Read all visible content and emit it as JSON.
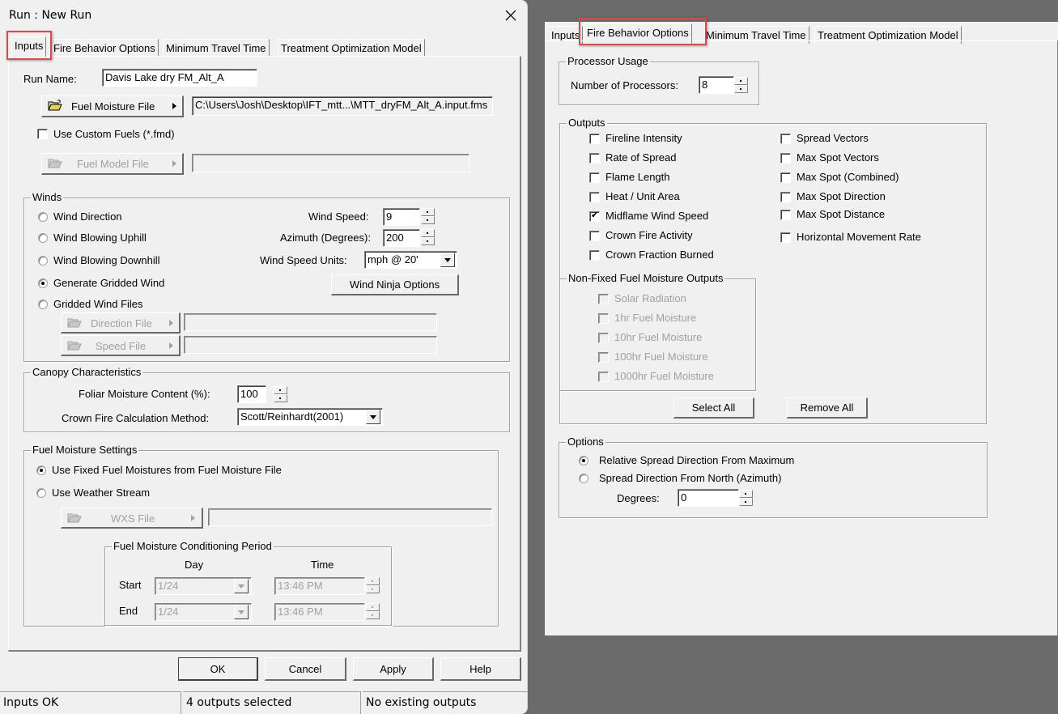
{
  "dialog": {
    "title": "Run : New Run",
    "close_icon": "close-icon",
    "tabs": [
      {
        "label": "Inputs",
        "active": true
      },
      {
        "label": "Fire Behavior Options",
        "active": false
      },
      {
        "label": "Minimum Travel Time",
        "active": false
      },
      {
        "label": "Treatment Optimization Model",
        "active": false
      }
    ],
    "inputs_tab": {
      "run_name_label": "Run Name:",
      "run_name_value": "Davis Lake dry FM_Alt_A",
      "fuel_moisture_button": "Fuel Moisture File",
      "fuel_moisture_path": "C:\\Users\\Josh\\Desktop\\IFT_mtt...\\MTT_dryFM_Alt_A.input.fms",
      "custom_fuels_label": "Use Custom Fuels (*.fmd)",
      "custom_fuels_checked": false,
      "fuel_model_button": "Fuel Model File",
      "fuel_model_path": "",
      "winds": {
        "title": "Winds",
        "options": [
          {
            "label": "Wind Direction",
            "selected": false
          },
          {
            "label": "Wind Blowing Uphill",
            "selected": false
          },
          {
            "label": "Wind Blowing Downhill",
            "selected": false
          },
          {
            "label": "Generate Gridded Wind",
            "selected": true
          },
          {
            "label": "Gridded Wind Files",
            "selected": false
          }
        ],
        "wind_speed_label": "Wind Speed:",
        "wind_speed_value": "9",
        "azimuth_label": "Azimuth (Degrees):",
        "azimuth_value": "200",
        "units_label": "Wind Speed Units:",
        "units_value": "mph @ 20'",
        "wind_ninja_button": "Wind Ninja Options",
        "direction_file_button": "Direction File",
        "direction_file_path": "",
        "speed_file_button": "Speed File",
        "speed_file_path": ""
      },
      "canopy": {
        "title": "Canopy Characteristics",
        "foliar_label": "Foliar Moisture Content (%):",
        "foliar_value": "100",
        "crown_method_label": "Crown Fire Calculation Method:",
        "crown_method_value": "Scott/Reinhardt(2001)"
      },
      "fuel_moisture_settings": {
        "title": "Fuel Moisture Settings",
        "options": [
          {
            "label": "Use Fixed Fuel Moistures from Fuel Moisture File",
            "selected": true
          },
          {
            "label": "Use Weather Stream",
            "selected": false
          }
        ],
        "wxs_button": "WXS File",
        "wxs_path": "",
        "conditioning": {
          "title": "Fuel Moisture Conditioning Period",
          "day_header": "Day",
          "time_header": "Time",
          "start_label": "Start",
          "start_day": "1/24",
          "start_time": "13:46 PM",
          "end_label": "End",
          "end_day": "1/24",
          "end_time": "13:46 PM"
        }
      }
    },
    "buttons": {
      "ok": "OK",
      "cancel": "Cancel",
      "apply": "Apply",
      "help": "Help"
    },
    "status": [
      "Inputs OK",
      "4 outputs selected",
      "No existing outputs"
    ]
  },
  "fire_behavior_window": {
    "tabs": [
      {
        "label": "Inputs",
        "active": false
      },
      {
        "label": "Fire Behavior Options",
        "active": true
      },
      {
        "label": "Minimum Travel Time",
        "active": false
      },
      {
        "label": "Treatment Optimization Model",
        "active": false
      }
    ],
    "processor": {
      "title": "Processor Usage",
      "label": "Number of Processors:",
      "value": "8"
    },
    "outputs": {
      "title": "Outputs",
      "left": [
        {
          "label": "Fireline Intensity",
          "checked": false
        },
        {
          "label": "Rate of Spread",
          "checked": false
        },
        {
          "label": "Flame Length",
          "checked": false
        },
        {
          "label": "Heat / Unit Area",
          "checked": false
        },
        {
          "label": "Midflame Wind Speed",
          "checked": true
        },
        {
          "label": "Crown Fire Activity",
          "checked": false
        },
        {
          "label": "Crown Fraction Burned",
          "checked": false
        }
      ],
      "right": [
        {
          "label": "Spread Vectors",
          "checked": false
        },
        {
          "label": "Max Spot Vectors",
          "checked": false
        },
        {
          "label": "Max Spot (Combined)",
          "checked": false
        },
        {
          "label": "Max Spot Direction",
          "checked": false
        },
        {
          "label": "Max Spot Distance",
          "checked": false
        },
        {
          "label": "Horizontal Movement Rate",
          "checked": false
        }
      ],
      "non_fixed": {
        "title": "Non-Fixed Fuel Moisture Outputs",
        "items": [
          {
            "label": "Solar Radiation",
            "checked": false
          },
          {
            "label": "1hr Fuel Moisture",
            "checked": false
          },
          {
            "label": "10hr Fuel Moisture",
            "checked": false
          },
          {
            "label": "100hr Fuel Moisture",
            "checked": false
          },
          {
            "label": "1000hr Fuel Moisture",
            "checked": false
          }
        ]
      },
      "select_all": "Select All",
      "remove_all": "Remove All"
    },
    "options": {
      "title": "Options",
      "radios": [
        {
          "label": "Relative Spread Direction From Maximum",
          "selected": true
        },
        {
          "label": "Spread Direction From North (Azimuth)",
          "selected": false
        }
      ],
      "degrees_label": "Degrees:",
      "degrees_value": "0"
    }
  },
  "colors": {
    "highlight": "#e04848",
    "background": "#6b6b6b",
    "window": "#f0f0f0"
  }
}
